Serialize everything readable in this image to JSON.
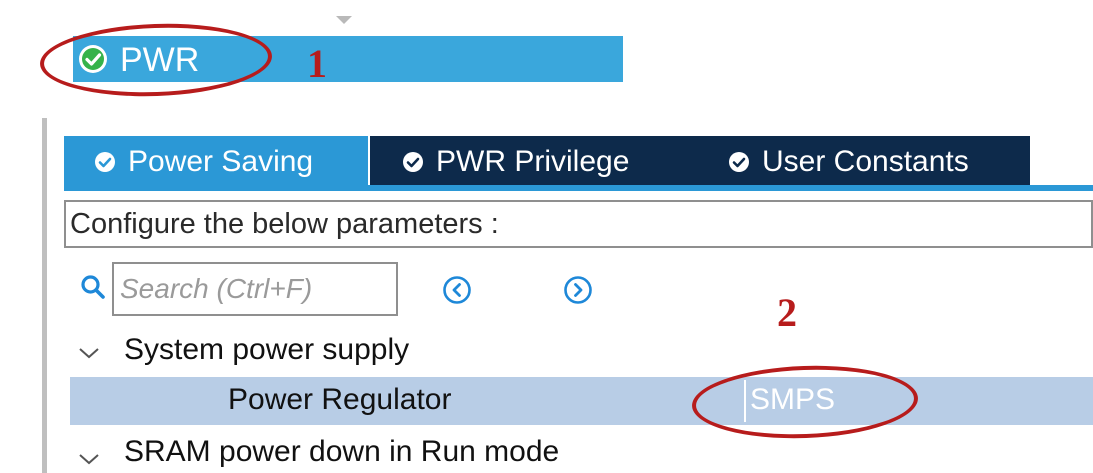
{
  "header": {
    "title": "PWR"
  },
  "annotations": {
    "step1": "1",
    "step2": "2",
    "color": "#b71c1c"
  },
  "tabs": [
    {
      "label": "Power Saving",
      "active": true
    },
    {
      "label": "PWR Privilege",
      "active": false
    },
    {
      "label": "User Constants",
      "active": false
    }
  ],
  "config": {
    "text": "Configure the below parameters :"
  },
  "search": {
    "placeholder": "Search (Ctrl+F)"
  },
  "tree": {
    "groups": [
      {
        "label": "System power supply",
        "params": [
          {
            "name": "Power Regulator",
            "value": "SMPS"
          }
        ]
      },
      {
        "label": "SRAM power down in Run mode"
      }
    ]
  },
  "colors": {
    "accent": "#2b98d6",
    "header_bar": "#3aa7dc",
    "tab_inactive": "#0d2a4b",
    "row_selected": "#b8cde6"
  },
  "icons": [
    "check-circle-icon",
    "search-icon",
    "chevron-left-circle-icon",
    "chevron-right-circle-icon",
    "chevron-down-icon"
  ]
}
